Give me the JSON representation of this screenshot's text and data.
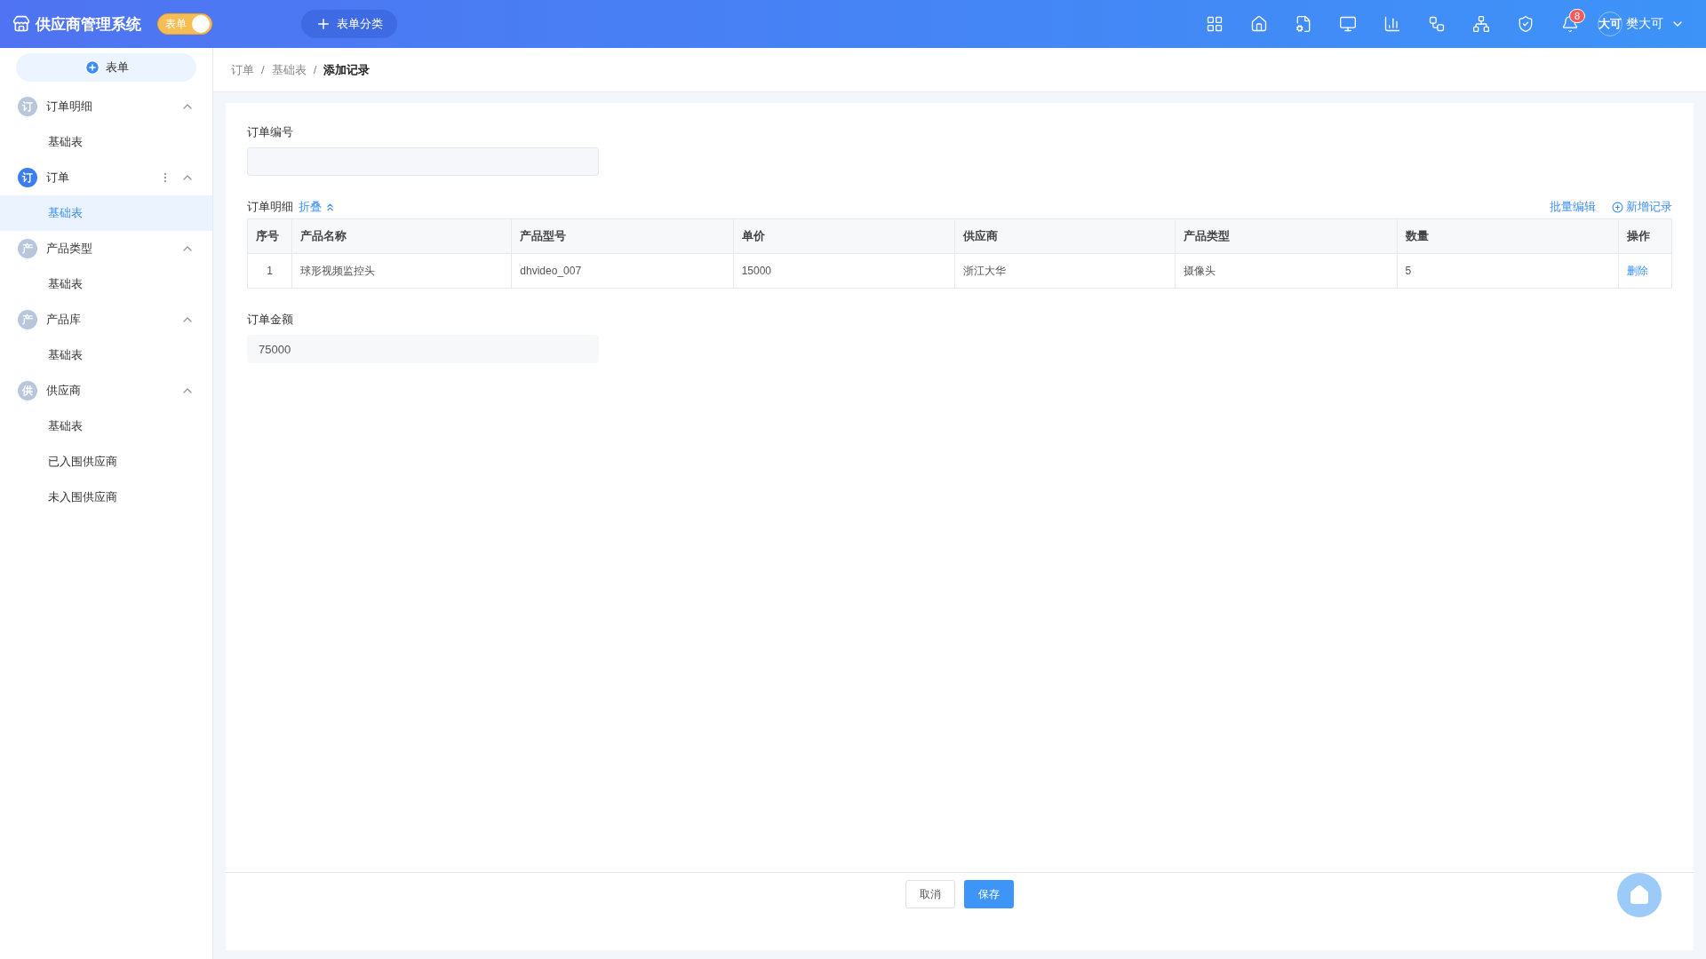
{
  "header": {
    "title": "供应商管理系统",
    "toggle": {
      "label": "表单",
      "on": true
    },
    "add_category": "表单分类",
    "notification_count": "8",
    "avatar": "大可",
    "user": "樊大可"
  },
  "sidebar": {
    "new_button": "表单",
    "groups": [
      {
        "icon_text": "订",
        "label": "订单明细",
        "active": false,
        "expanded": true,
        "children": [
          {
            "label": "基础表",
            "selected": false
          }
        ]
      },
      {
        "icon_text": "订",
        "label": "订单",
        "active": true,
        "expanded": true,
        "children": [
          {
            "label": "基础表",
            "selected": true
          }
        ]
      },
      {
        "icon_text": "产",
        "label": "产品类型",
        "active": false,
        "expanded": true,
        "children": [
          {
            "label": "基础表",
            "selected": false
          }
        ]
      },
      {
        "icon_text": "产",
        "label": "产品库",
        "active": false,
        "expanded": true,
        "children": [
          {
            "label": "基础表",
            "selected": false
          }
        ]
      },
      {
        "icon_text": "供",
        "label": "供应商",
        "active": false,
        "expanded": true,
        "children": [
          {
            "label": "基础表",
            "selected": false
          },
          {
            "label": "已入围供应商",
            "selected": false
          },
          {
            "label": "未入围供应商",
            "selected": false
          }
        ]
      }
    ]
  },
  "breadcrumb": {
    "items": [
      "订单",
      "基础表",
      "添加记录"
    ],
    "separators": [
      "/",
      "/"
    ]
  },
  "form": {
    "order_no_label": "订单编号",
    "details_label": "订单明细",
    "collapse": "折叠",
    "batch_edit": "批量编辑",
    "add_record": "新增记录",
    "table": {
      "columns": [
        "序号",
        "产品名称",
        "产品型号",
        "单价",
        "供应商",
        "产品类型",
        "数量",
        "操作"
      ],
      "rows": [
        {
          "cells": [
            "1",
            "球形视频监控头",
            "dhvideo_007",
            "15000",
            "浙江大华",
            "摄像头",
            "5"
          ],
          "action": "删除"
        }
      ]
    },
    "amount_label": "订单金额",
    "amount_value": "75000"
  },
  "footer": {
    "cancel": "取消",
    "save": "保存"
  }
}
